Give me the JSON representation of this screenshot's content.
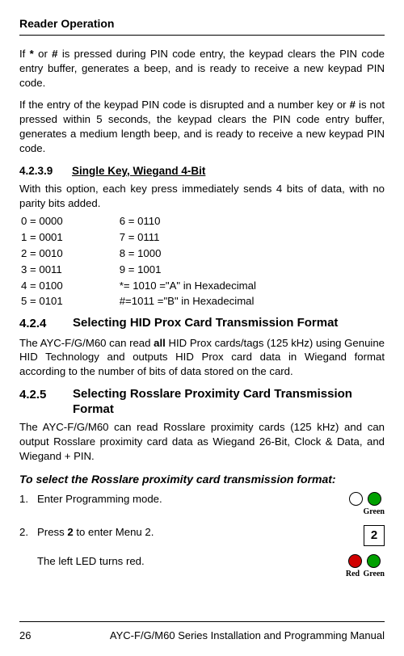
{
  "header": {
    "title": "Reader Operation"
  },
  "paras": {
    "p1a": "If ",
    "p1b": " or ",
    "p1c": " is pressed during PIN code entry, the keypad clears the PIN code entry buffer, generates a beep, and is ready to receive a new keypad PIN code.",
    "star": "*",
    "hash": "#",
    "p2a": "If the entry of the keypad PIN code is disrupted and a number key or ",
    "p2b": " is not pressed within 5 seconds, the keypad clears the PIN code entry buffer, generates a medium length beep, and is ready to receive a new keypad PIN code."
  },
  "sub1": {
    "num": "4.2.3.9",
    "name": "Single Key, Wiegand 4-Bit",
    "desc": "With this option, each key press immediately sends 4 bits of data, with no parity bits added."
  },
  "bits": {
    "left": [
      "0 = 0000",
      "1 = 0001",
      "2 = 0010",
      "3 = 0011",
      "4 = 0100",
      "5 = 0101"
    ],
    "right": [
      "6 = 0110",
      "7 = 0111",
      "8 = 1000",
      "9 = 1001",
      "*= 1010 =\"A\" in Hexadecimal",
      "#=1011 =\"B\" in Hexadecimal"
    ]
  },
  "h3a": {
    "num": "4.2.4",
    "name": "Selecting HID Prox Card Transmission Format",
    "body_a": "The AYC-F/G/M60 can read ",
    "body_bold": "all",
    "body_b": " HID Prox cards/tags (125 kHz) using Genuine HID Technology and outputs HID Prox card data in Wiegand format according to the number of bits of data stored on the card."
  },
  "h3b": {
    "num": "4.2.5",
    "name": "Selecting Rosslare Proximity Card Transmission Format",
    "body": "The AYC-F/G/M60 can read Rosslare proximity cards (125 kHz) and can output Rosslare proximity card data as Wiegand 26-Bit, Clock & Data, and Wiegand + PIN."
  },
  "italic": "To select the Rosslare proximity card transmission format:",
  "steps": {
    "s1": {
      "num": "1.",
      "text": "Enter Programming mode.",
      "label_r": "Green"
    },
    "s2": {
      "num": "2.",
      "text_a": "Press ",
      "text_bold": "2",
      "text_b": " to enter Menu 2.",
      "key": "2"
    },
    "s3": {
      "text": "The left LED turns red.",
      "label_l": "Red",
      "label_r": "Green"
    }
  },
  "footer": {
    "page": "26",
    "text": "AYC-F/G/M60 Series Installation and Programming Manual"
  }
}
